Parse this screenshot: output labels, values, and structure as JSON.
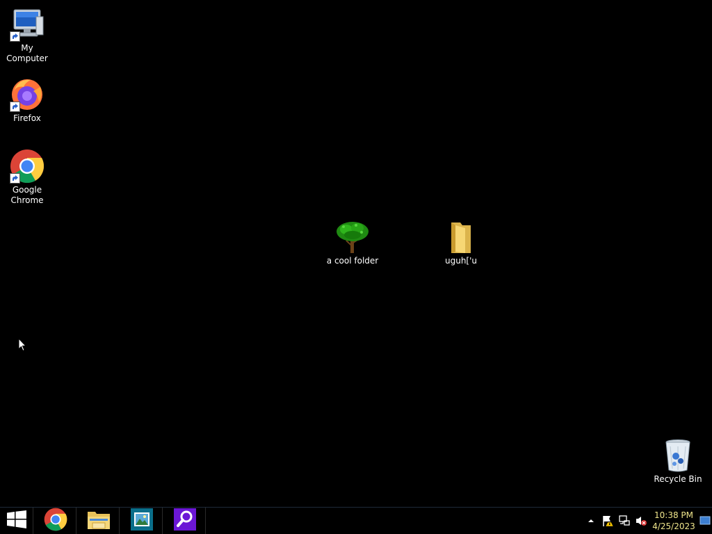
{
  "desktop": {
    "icons": [
      {
        "id": "my-computer",
        "label": "My Computer",
        "icon": "computer-icon",
        "shortcut": true
      },
      {
        "id": "firefox",
        "label": "Firefox",
        "icon": "firefox-icon",
        "shortcut": true
      },
      {
        "id": "google-chrome",
        "label": "Google Chrome",
        "icon": "chrome-icon",
        "shortcut": true
      },
      {
        "id": "a-cool-folder",
        "label": "a cool folder",
        "icon": "tree-icon",
        "shortcut": false
      },
      {
        "id": "uguh-folder",
        "label": "uguh['u",
        "icon": "folder-icon",
        "shortcut": false
      },
      {
        "id": "recycle-bin",
        "label": "Recycle Bin",
        "icon": "recycle-bin-icon",
        "shortcut": false
      }
    ]
  },
  "taskbar": {
    "pinned": [
      {
        "id": "start",
        "icon": "windows-logo-icon"
      },
      {
        "id": "chrome",
        "icon": "chrome-icon"
      },
      {
        "id": "file-explorer",
        "icon": "file-explorer-icon"
      },
      {
        "id": "photo-viewer",
        "icon": "photo-viewer-icon"
      },
      {
        "id": "search-app",
        "icon": "magnifier-icon"
      }
    ],
    "tray": {
      "icons": [
        "show-hidden-icons-chevron-icon",
        "action-center-flag-icon",
        "network-icon",
        "volume-muted-icon"
      ],
      "clock": {
        "time": "10:38 PM",
        "date": "4/25/2023"
      }
    }
  },
  "colors": {
    "desktop_bg": "#000000",
    "clock_text": "#f0e68c",
    "photo_tile": "#0a6e8a",
    "search_tile": "#6b17d6"
  }
}
